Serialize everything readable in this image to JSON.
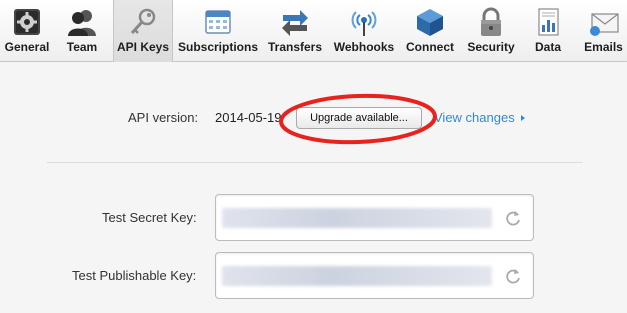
{
  "toolbar": {
    "items": [
      {
        "label": "General",
        "icon": "gear-icon"
      },
      {
        "label": "Team",
        "icon": "team-icon"
      },
      {
        "label": "API Keys",
        "icon": "key-icon",
        "active": true
      },
      {
        "label": "Subscriptions",
        "icon": "calendar-icon"
      },
      {
        "label": "Transfers",
        "icon": "transfer-arrows-icon"
      },
      {
        "label": "Webhooks",
        "icon": "antenna-icon"
      },
      {
        "label": "Connect",
        "icon": "cube-icon"
      },
      {
        "label": "Security",
        "icon": "lock-icon"
      },
      {
        "label": "Data",
        "icon": "report-icon"
      },
      {
        "label": "Emails",
        "icon": "envelope-icon"
      }
    ]
  },
  "api": {
    "version_label": "API version:",
    "version_value": "2014-05-19",
    "upgrade_label": "Upgrade available...",
    "view_changes_label": "View changes"
  },
  "keys": {
    "secret_label": "Test Secret Key:",
    "publishable_label": "Test Publishable Key:"
  },
  "colors": {
    "link": "#2e8ad8",
    "annotation_circle": "#e8231f",
    "active_tab": "#dcdcdc"
  }
}
